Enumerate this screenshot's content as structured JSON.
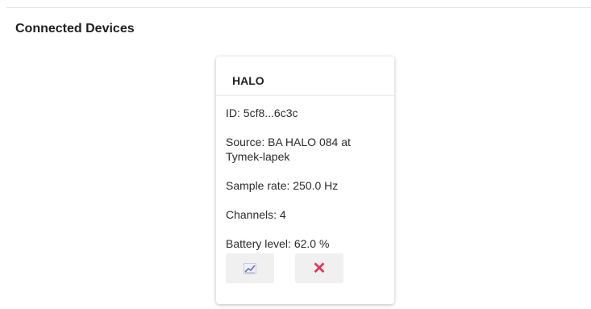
{
  "header": {
    "title": "Connected Devices"
  },
  "device": {
    "name": "HALO",
    "id": "ID: 5cf8...6c3c",
    "source": "Source: BA HALO 084 at Tymek-lapek",
    "sample_rate": "Sample rate: 250.0 Hz",
    "channels": "Channels: 4",
    "battery": "Battery level: 62.0 %",
    "actions": {
      "chart_icon": "chart-line-icon",
      "disconnect_icon": "close-icon",
      "disconnect_glyph": "✕",
      "disconnect_color": "#e0355a"
    }
  }
}
